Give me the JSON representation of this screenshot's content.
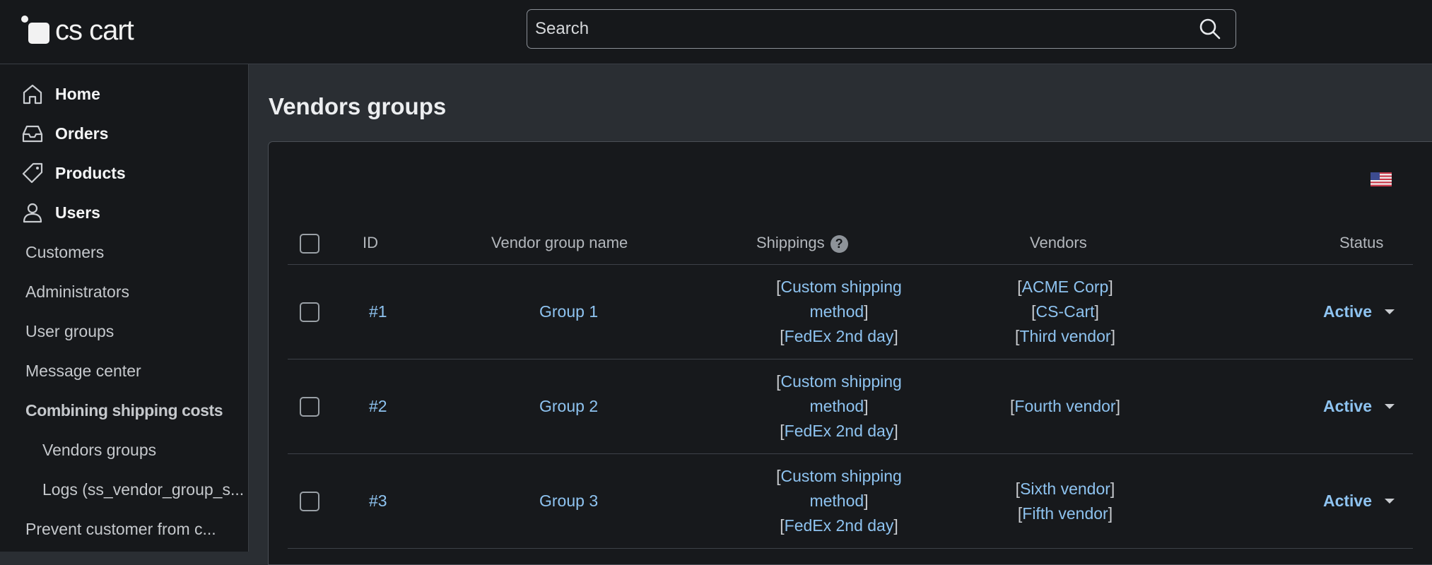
{
  "brand": {
    "name": "cs cart"
  },
  "search": {
    "placeholder": "Search"
  },
  "sidebar": {
    "main_items": [
      {
        "label": "Home",
        "icon": "home-icon"
      },
      {
        "label": "Orders",
        "icon": "inbox-icon"
      },
      {
        "label": "Products",
        "icon": "tag-icon"
      },
      {
        "label": "Users",
        "icon": "user-icon"
      }
    ],
    "sub_items": [
      {
        "label": "Customers"
      },
      {
        "label": "Administrators"
      },
      {
        "label": "User groups"
      },
      {
        "label": "Message center"
      },
      {
        "label": "Combining shipping costs"
      },
      {
        "label": "Vendors groups"
      },
      {
        "label": "Logs (ss_vendor_group_s..."
      },
      {
        "label": "Prevent customer from c..."
      }
    ]
  },
  "page": {
    "title": "Vendors groups",
    "language_flag": "us-flag-icon"
  },
  "table": {
    "headers": {
      "id": "ID",
      "name": "Vendor group name",
      "shippings": "Shippings",
      "vendors": "Vendors",
      "status": "Status"
    },
    "help_symbol": "?",
    "rows": [
      {
        "id": "#1",
        "name": "Group 1",
        "shippings": [
          "Custom shipping",
          "method",
          "FedEx 2nd day"
        ],
        "vendors": [
          "ACME Corp",
          "CS-Cart",
          "Third vendor"
        ],
        "status": "Active"
      },
      {
        "id": "#2",
        "name": "Group 2",
        "shippings": [
          "Custom shipping",
          "method",
          "FedEx 2nd day"
        ],
        "vendors": [
          "Fourth vendor"
        ],
        "status": "Active"
      },
      {
        "id": "#3",
        "name": "Group 3",
        "shippings": [
          "Custom shipping",
          "method",
          "FedEx 2nd day"
        ],
        "vendors": [
          "Sixth vendor",
          "Fifth vendor"
        ],
        "status": "Active"
      }
    ]
  }
}
